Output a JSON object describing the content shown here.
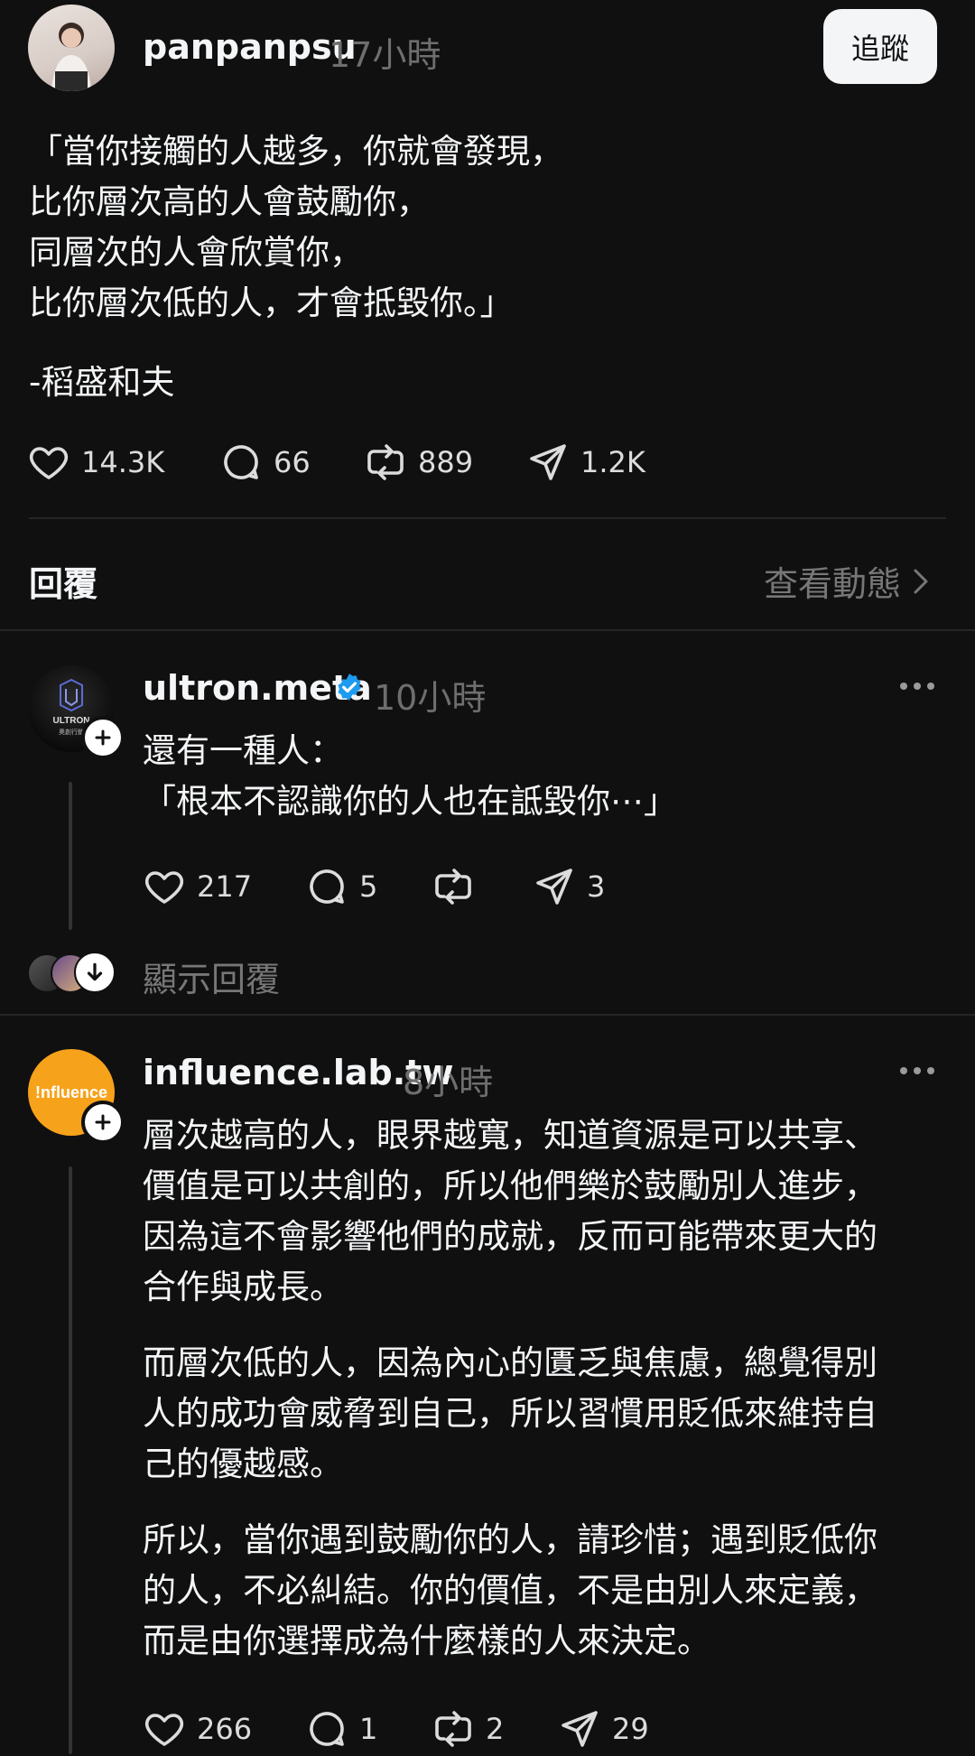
{
  "post": {
    "username": "panpanpsu",
    "time": "17小時",
    "follow_label": "追蹤",
    "lines": [
      "「當你接觸的人越多，你就會發現，",
      "比你層次高的人會鼓勵你，",
      "同層次的人會欣賞你，",
      "比你層次低的人，才會抵毀你。」"
    ],
    "signature": "-稻盛和夫",
    "likes": "14.3K",
    "comments": "66",
    "reposts": "889",
    "shares": "1.2K"
  },
  "replies_header": {
    "title": "回覆",
    "view_activity": "查看動態"
  },
  "reply1": {
    "username": "ultron.meta",
    "verified": true,
    "time": "10小時",
    "lines": [
      "還有一種人：",
      "「根本不認識你的人也在詆毀你⋯」"
    ],
    "likes": "217",
    "comments": "5",
    "reposts": "",
    "shares": "3",
    "show_replies": "顯示回覆",
    "avatar_text": "ULTRON",
    "avatar_subtext": "奧創行銷"
  },
  "reply2": {
    "username": "influence.lab.tw",
    "time": "8小時",
    "avatar_text": "!nfluence",
    "paragraphs": [
      [
        "層次越高的人，眼界越寬，知道資源是可以共享、",
        "價值是可以共創的，所以他們樂於鼓勵別人進步，",
        "因為這不會影響他們的成就，反而可能帶來更大的",
        "合作與成長。"
      ],
      [
        "而層次低的人，因為內心的匱乏與焦慮，總覺得別",
        "人的成功會威脅到自己，所以習慣用貶低來維持自",
        "己的優越感。"
      ],
      [
        "所以，當你遇到鼓勵你的人，請珍惜；遇到貶低你",
        "的人，不必糾結。你的價值，不是由別人來定義，",
        "而是由你選擇成為什麼樣的人來決定。"
      ]
    ],
    "likes": "266",
    "comments": "1",
    "reposts": "2",
    "shares": "29"
  },
  "colors": {
    "background": "#101010",
    "text": "#f3f5f7",
    "muted": "#6e6e6e",
    "verified": "#1d9bf0",
    "influence_orange": "#f7a21b"
  }
}
